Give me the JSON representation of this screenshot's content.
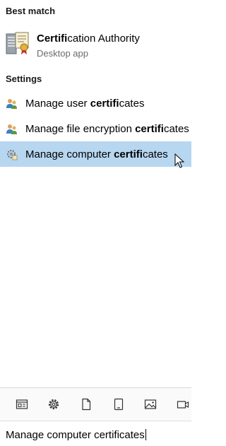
{
  "sections": {
    "best_match_header": "Best match",
    "settings_header": "Settings"
  },
  "best_match": {
    "title_bold": "Certifi",
    "title_rest": "cation Authority",
    "subtitle": "Desktop app",
    "icon": "server-certificate-icon"
  },
  "settings_results": [
    {
      "pre": "Manage user ",
      "bold": "certifi",
      "post": "cates",
      "icon": "users-icon",
      "selected": false
    },
    {
      "pre": "Manage file encryption ",
      "bold": "certifi",
      "post": "cates",
      "icon": "users-icon",
      "selected": false
    },
    {
      "pre": "Manage computer ",
      "bold": "certifi",
      "post": "cates",
      "icon": "gear-certificate-icon",
      "selected": true
    }
  ],
  "filters": [
    {
      "name": "apps-filter",
      "icon": "app-window-icon"
    },
    {
      "name": "settings-filter",
      "icon": "gear-icon"
    },
    {
      "name": "documents-filter",
      "icon": "document-icon"
    },
    {
      "name": "tablet-filter",
      "icon": "tablet-icon"
    },
    {
      "name": "photos-filter",
      "icon": "photo-icon"
    },
    {
      "name": "videos-filter",
      "icon": "video-icon"
    }
  ],
  "search": {
    "value": "Manage computer certificates"
  },
  "colors": {
    "selection": "#b7d6f0",
    "subtitle": "#6b6b6b"
  }
}
